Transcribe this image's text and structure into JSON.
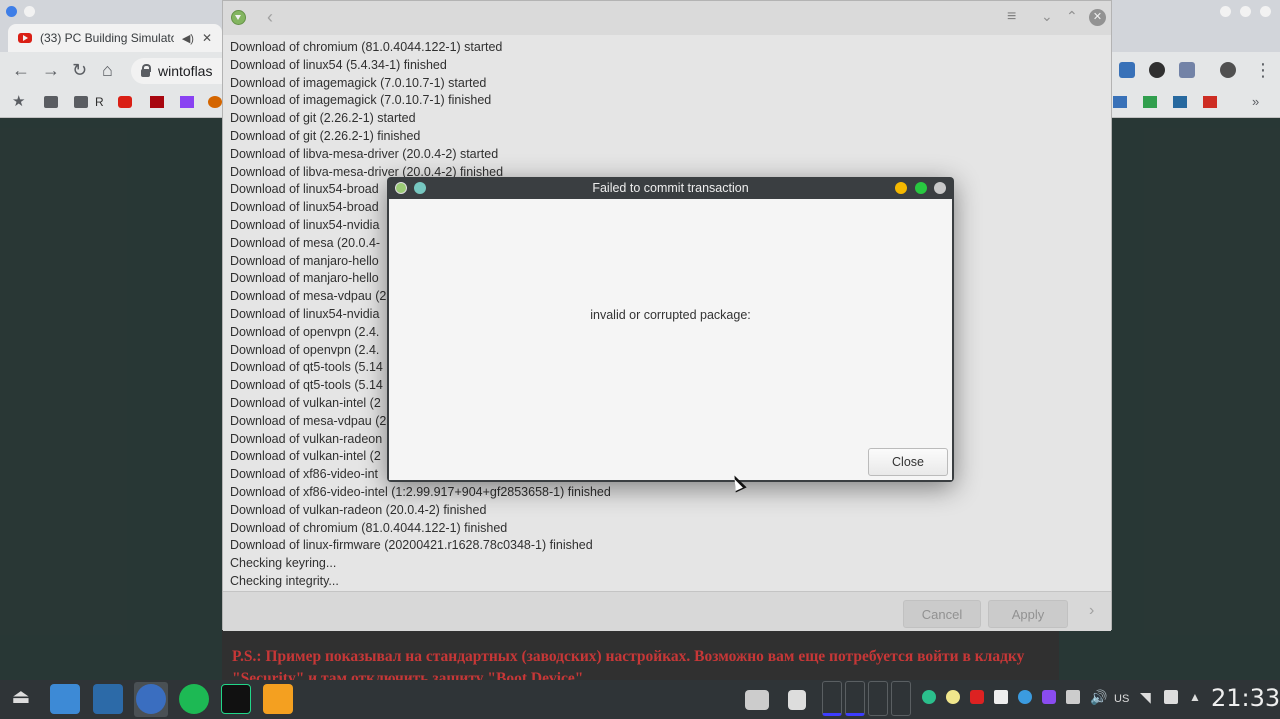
{
  "browser": {
    "tab_title": "(33) PC Building Simulato",
    "url": "wintoflas",
    "bookmark_label_r": "R"
  },
  "pamac": {
    "log_lines": [
      "Download of chromium (81.0.4044.122-1) started",
      "Download of linux54 (5.4.34-1) finished",
      "Download of imagemagick (7.0.10.7-1) started",
      "Download of imagemagick (7.0.10.7-1) finished",
      "Download of git (2.26.2-1) started",
      "Download of git (2.26.2-1) finished",
      "Download of libva-mesa-driver (20.0.4-2) started",
      "Download of libva-mesa-driver (20.0.4-2) finished",
      "Download of linux54-broad",
      "Download of linux54-broad",
      "Download of linux54-nvidia",
      "Download of mesa (20.0.4-",
      "Download of manjaro-hello",
      "Download of manjaro-hello",
      "Download of mesa-vdpau (2",
      "Download of linux54-nvidia",
      "Download of openvpn (2.4.",
      "Download of openvpn (2.4.",
      "Download of qt5-tools (5.14",
      "Download of qt5-tools (5.14",
      "Download of vulkan-intel (2",
      "Download of mesa-vdpau (2",
      "Download of vulkan-radeon",
      "Download of vulkan-intel (2",
      "Download of xf86-video-int",
      "Download of xf86-video-intel (1:2.99.917+904+gf2853658-1) finished",
      "Download of vulkan-radeon (20.0.4-2) finished",
      "Download of chromium (81.0.4044.122-1) finished",
      "Download of linux-firmware (20200421.r1628.78c0348-1) finished",
      "Checking keyring...",
      "Checking integrity..."
    ],
    "cancel_label": "Cancel",
    "apply_label": "Apply"
  },
  "dialog": {
    "title": "Failed to commit transaction",
    "message": "invalid or corrupted package:",
    "close_label": "Close"
  },
  "article": {
    "text": "P.S.: Пример показывал на стандартных (заводских) настройках. Возможно вам еще потребуется войти в кладку \"Security\" и там отключить защиту \"Boot Device\"."
  },
  "taskbar": {
    "keyboard_layout": "US",
    "clock": "21:33"
  },
  "icons": [
    "download-icon",
    "back-arrow-icon",
    "hamburger-menu-icon",
    "chevron-down-icon",
    "chevron-up-icon",
    "close-icon",
    "forward-arrow-icon",
    "reload-icon",
    "home-icon",
    "lock-icon",
    "star-icon",
    "folder-icon",
    "youtube-icon",
    "netflix-icon",
    "twitch-icon",
    "wifi-icon",
    "volume-icon",
    "battery-icon"
  ]
}
